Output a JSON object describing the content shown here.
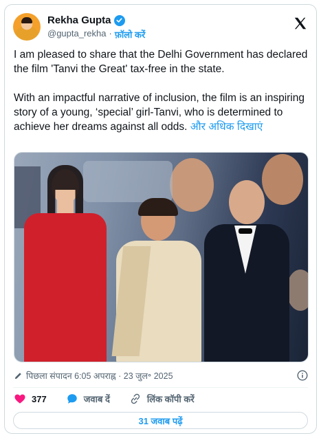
{
  "author": {
    "display_name": "Rekha Gupta",
    "handle": "@gupta_rekha",
    "separator": "·",
    "follow_label": "फ़ॉलो करें"
  },
  "tweet": {
    "paragraph1": "I am pleased to share that the Delhi Government has declared the film 'Tanvi the Great' tax-free in the state.",
    "paragraph2": "With an impactful narrative of inclusion, the film is an inspiring story of a young, ‘special’ girl-Tanvi, who is determined to achieve her dreams against all odds.",
    "show_more": "और अधिक दिखाएं"
  },
  "meta": {
    "edited_label": "पिछला संपादन 6:05 अपराह्न · 23 जुल॰ 2025"
  },
  "actions": {
    "like_count": "377",
    "reply_label": "जवाब दें",
    "copy_link_label": "लिंक कॉपी करें"
  },
  "replies_button": "31 जवाब पढ़ें",
  "colors": {
    "accent": "#1d9bf0",
    "like": "#f91880",
    "text": "#0f1419",
    "muted": "#536471"
  }
}
